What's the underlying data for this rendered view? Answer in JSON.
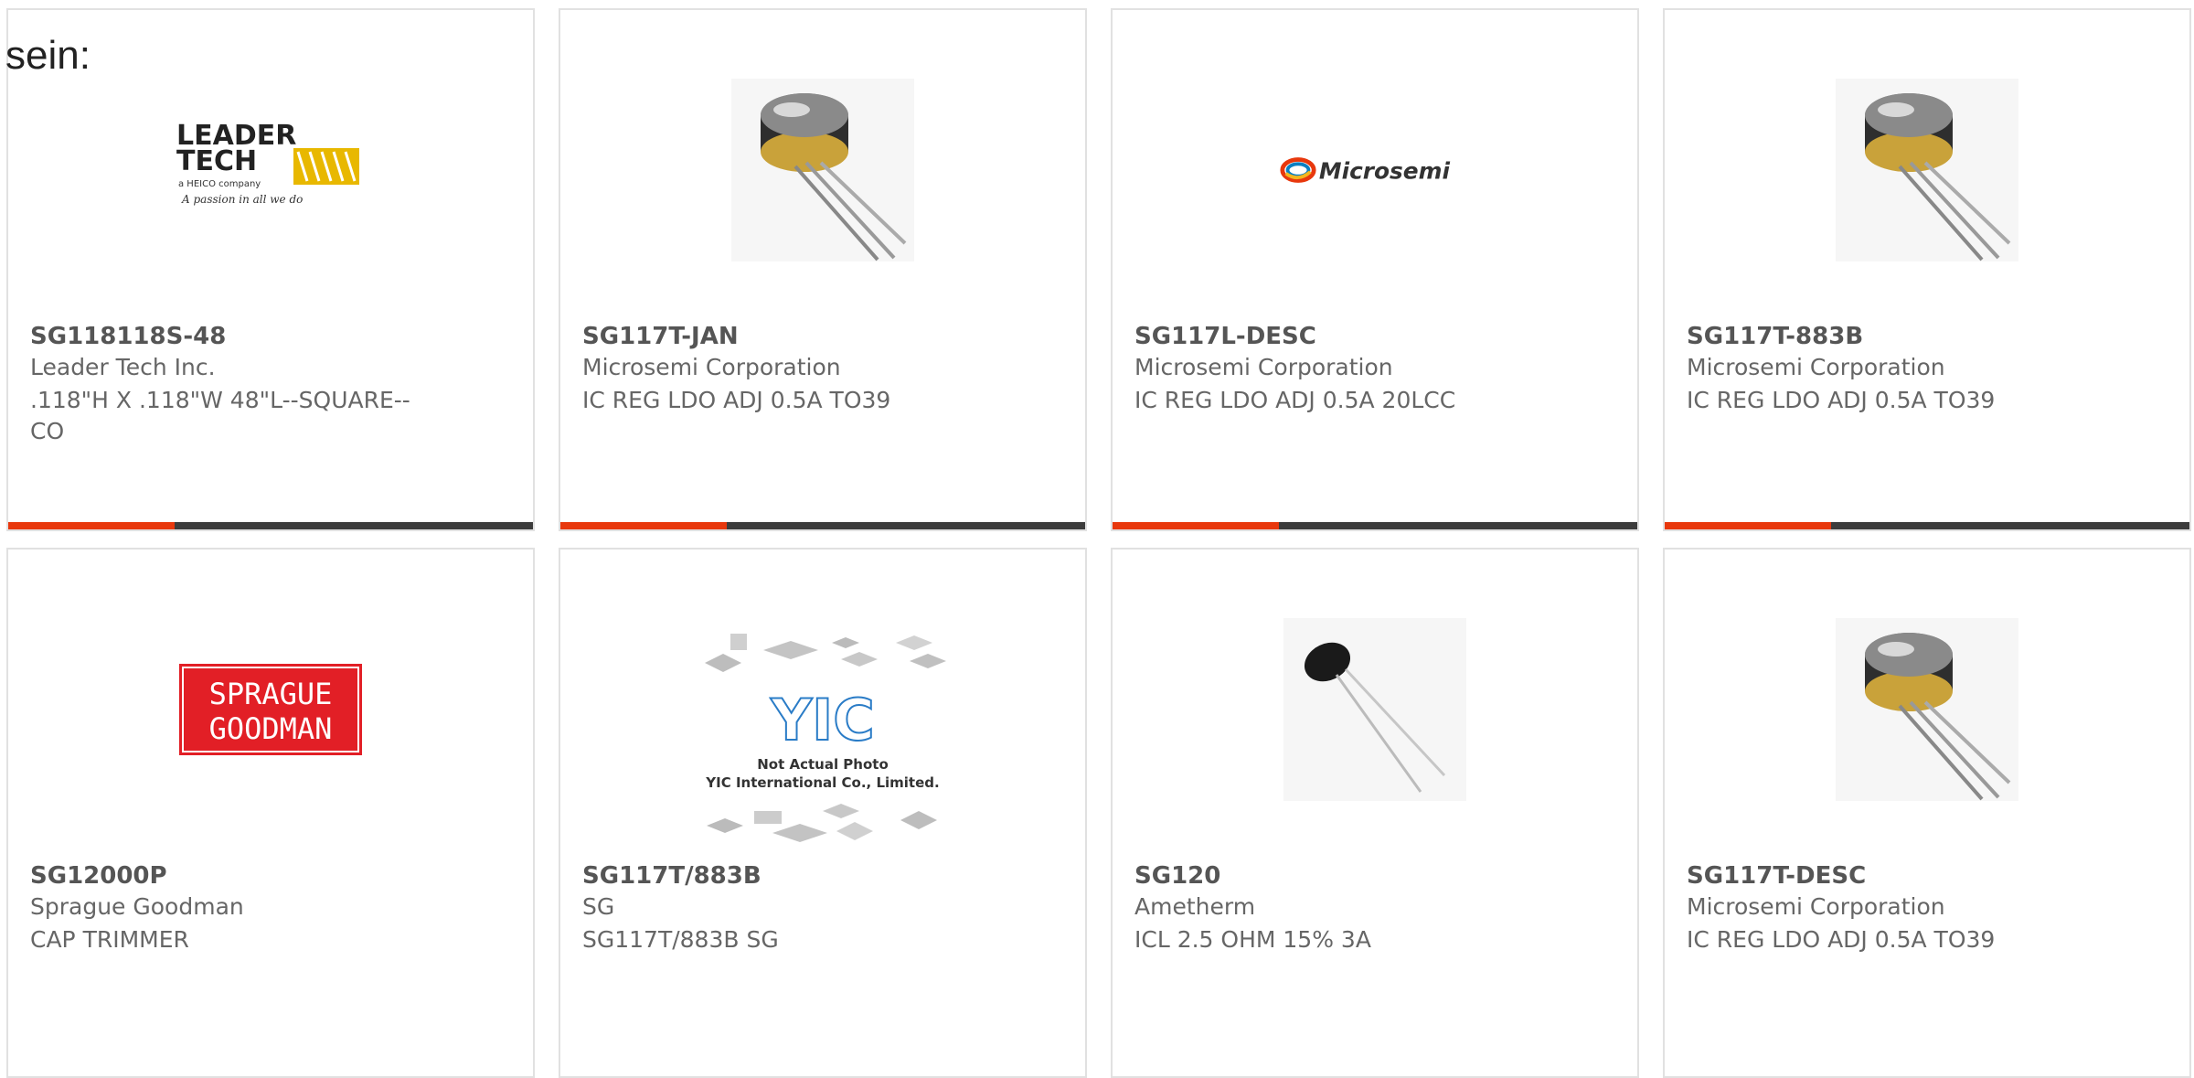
{
  "intro_text": "sein:",
  "colors": {
    "accent": "#e8380d",
    "bar": "#3c3c3c",
    "border": "#e1e1e1"
  },
  "products": [
    {
      "part": "SG118118S-48",
      "maker": "Leader Tech Inc.",
      "desc": ".118\"H X .118\"W 48\"L--SQUARE--CO",
      "image": "leader-tech-logo"
    },
    {
      "part": "SG117T-JAN",
      "maker": "Microsemi Corporation",
      "desc": "IC REG LDO ADJ 0.5A TO39",
      "image": "to39-can-photo"
    },
    {
      "part": "SG117L-DESC",
      "maker": "Microsemi Corporation",
      "desc": "IC REG LDO ADJ 0.5A 20LCC",
      "image": "microsemi-logo"
    },
    {
      "part": "SG117T-883B",
      "maker": "Microsemi Corporation",
      "desc": "IC REG LDO ADJ 0.5A TO39",
      "image": "to39-can-photo"
    },
    {
      "part": "SG12000P",
      "maker": "Sprague Goodman",
      "desc": "CAP TRIMMER",
      "image": "sprague-goodman-logo"
    },
    {
      "part": "SG117T/883B",
      "maker": "SG",
      "desc": "SG117T/883B SG",
      "image": "yic-placeholder"
    },
    {
      "part": "SG120",
      "maker": "Ametherm",
      "desc": "ICL 2.5 OHM 15% 3A",
      "image": "thermistor-photo"
    },
    {
      "part": "SG117T-DESC",
      "maker": "Microsemi Corporation",
      "desc": "IC REG LDO ADJ 0.5A TO39",
      "image": "to39-can-photo"
    }
  ],
  "logos": {
    "leader_line1": "LEADER",
    "leader_line2": "TECH",
    "leader_sub": "a HEICO company",
    "leader_tag": "A passion in all we do",
    "microsemi": "Microsemi",
    "sprague_line1": "SPRAGUE",
    "sprague_line2": "GOODMAN",
    "yic_mark": "YIC",
    "yic_line1": "Not Actual Photo",
    "yic_line2": "YIC International Co., Limited."
  }
}
